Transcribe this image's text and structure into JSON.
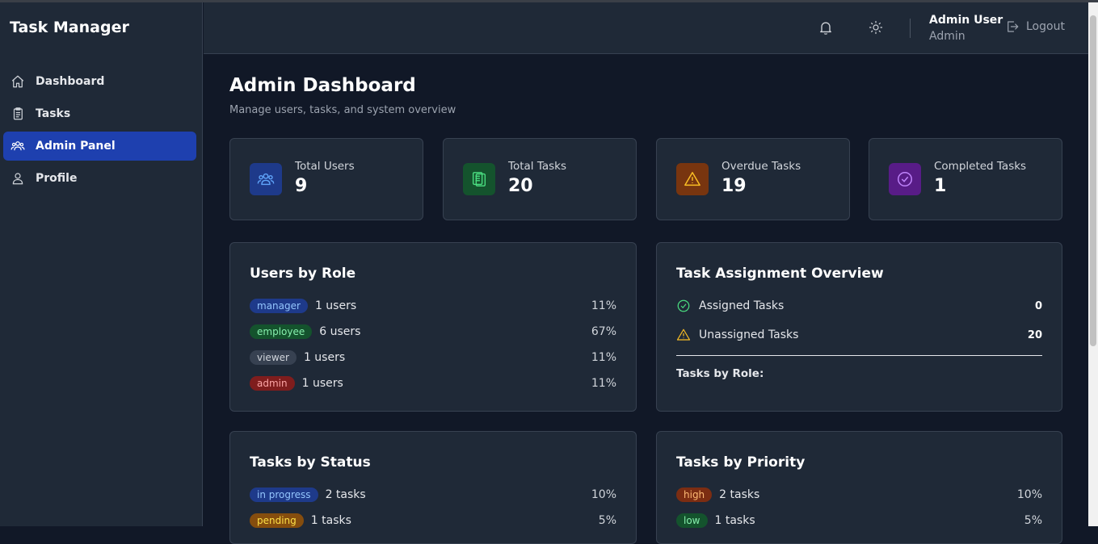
{
  "app": {
    "title": "Task Manager"
  },
  "sidebar": {
    "items": [
      {
        "label": "Dashboard",
        "icon": "home-icon"
      },
      {
        "label": "Tasks",
        "icon": "clipboard-icon"
      },
      {
        "label": "Admin Panel",
        "icon": "users-icon",
        "active": true
      },
      {
        "label": "Profile",
        "icon": "user-icon"
      }
    ]
  },
  "header": {
    "user_name": "Admin User",
    "user_role": "Admin",
    "logout_label": "Logout",
    "icons": [
      "bell-icon",
      "sun-icon",
      "logout-icon"
    ]
  },
  "page": {
    "title": "Admin Dashboard",
    "subtitle": "Manage users, tasks, and system overview"
  },
  "stats": [
    {
      "label": "Total Users",
      "value": "9",
      "icon": "users-icon",
      "color": "#3b82f6"
    },
    {
      "label": "Total Tasks",
      "value": "20",
      "icon": "clipboard-icon",
      "color": "#22c55e"
    },
    {
      "label": "Overdue Tasks",
      "value": "19",
      "icon": "warning-icon",
      "color": "#f59e0b"
    },
    {
      "label": "Completed Tasks",
      "value": "1",
      "icon": "check-circle-icon",
      "color": "#a855f7"
    }
  ],
  "users_by_role": {
    "title": "Users by Role",
    "rows": [
      {
        "badge": "manager",
        "text": "1 users",
        "pct": "11%"
      },
      {
        "badge": "employee",
        "text": "6 users",
        "pct": "67%"
      },
      {
        "badge": "viewer",
        "text": "1 users",
        "pct": "11%"
      },
      {
        "badge": "admin",
        "text": "1 users",
        "pct": "11%"
      }
    ]
  },
  "assignment": {
    "title": "Task Assignment Overview",
    "rows": [
      {
        "label": "Assigned Tasks",
        "value": "0",
        "icon": "check-circle-icon"
      },
      {
        "label": "Unassigned Tasks",
        "value": "20",
        "icon": "warning-icon"
      }
    ],
    "subhead": "Tasks by Role:"
  },
  "tasks_by_status": {
    "title": "Tasks by Status",
    "rows": [
      {
        "badge": "in progress",
        "text": "2 tasks",
        "pct": "10%"
      },
      {
        "badge": "pending",
        "text": "1 tasks",
        "pct": "5%"
      }
    ]
  },
  "tasks_by_priority": {
    "title": "Tasks by Priority",
    "rows": [
      {
        "badge": "high",
        "text": "2 tasks",
        "pct": "10%"
      },
      {
        "badge": "low",
        "text": "1 tasks",
        "pct": "5%"
      }
    ]
  },
  "colors": {
    "accent": "#1e40af",
    "background": "#111827",
    "surface": "#1f2937",
    "border": "#374151"
  }
}
